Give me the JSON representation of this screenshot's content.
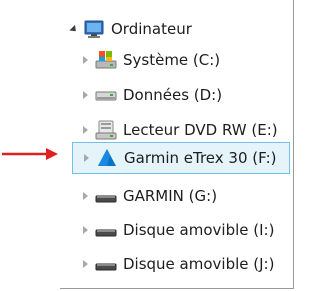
{
  "tree": {
    "root": {
      "label": "Ordinateur",
      "icon": "computer-icon",
      "expanded": true
    },
    "items": [
      {
        "label": "Système (C:)",
        "icon": "system-drive-icon"
      },
      {
        "label": "Données (D:)",
        "icon": "hard-drive-icon"
      },
      {
        "label": "Lecteur DVD RW (E:)",
        "icon": "dvd-drive-icon"
      },
      {
        "label": "Garmin eTrex 30 (F:)",
        "icon": "garmin-device-icon",
        "selected": true
      },
      {
        "label": "GARMIN (G:)",
        "icon": "removable-drive-icon"
      },
      {
        "label": "Disque amovible (I:)",
        "icon": "removable-drive-icon"
      },
      {
        "label": "Disque amovible (J:)",
        "icon": "removable-drive-icon"
      }
    ]
  },
  "colors": {
    "pointer_arrow": "#e02020",
    "selection_bg": "#e5f3fb",
    "selection_border": "#70c0e7"
  }
}
